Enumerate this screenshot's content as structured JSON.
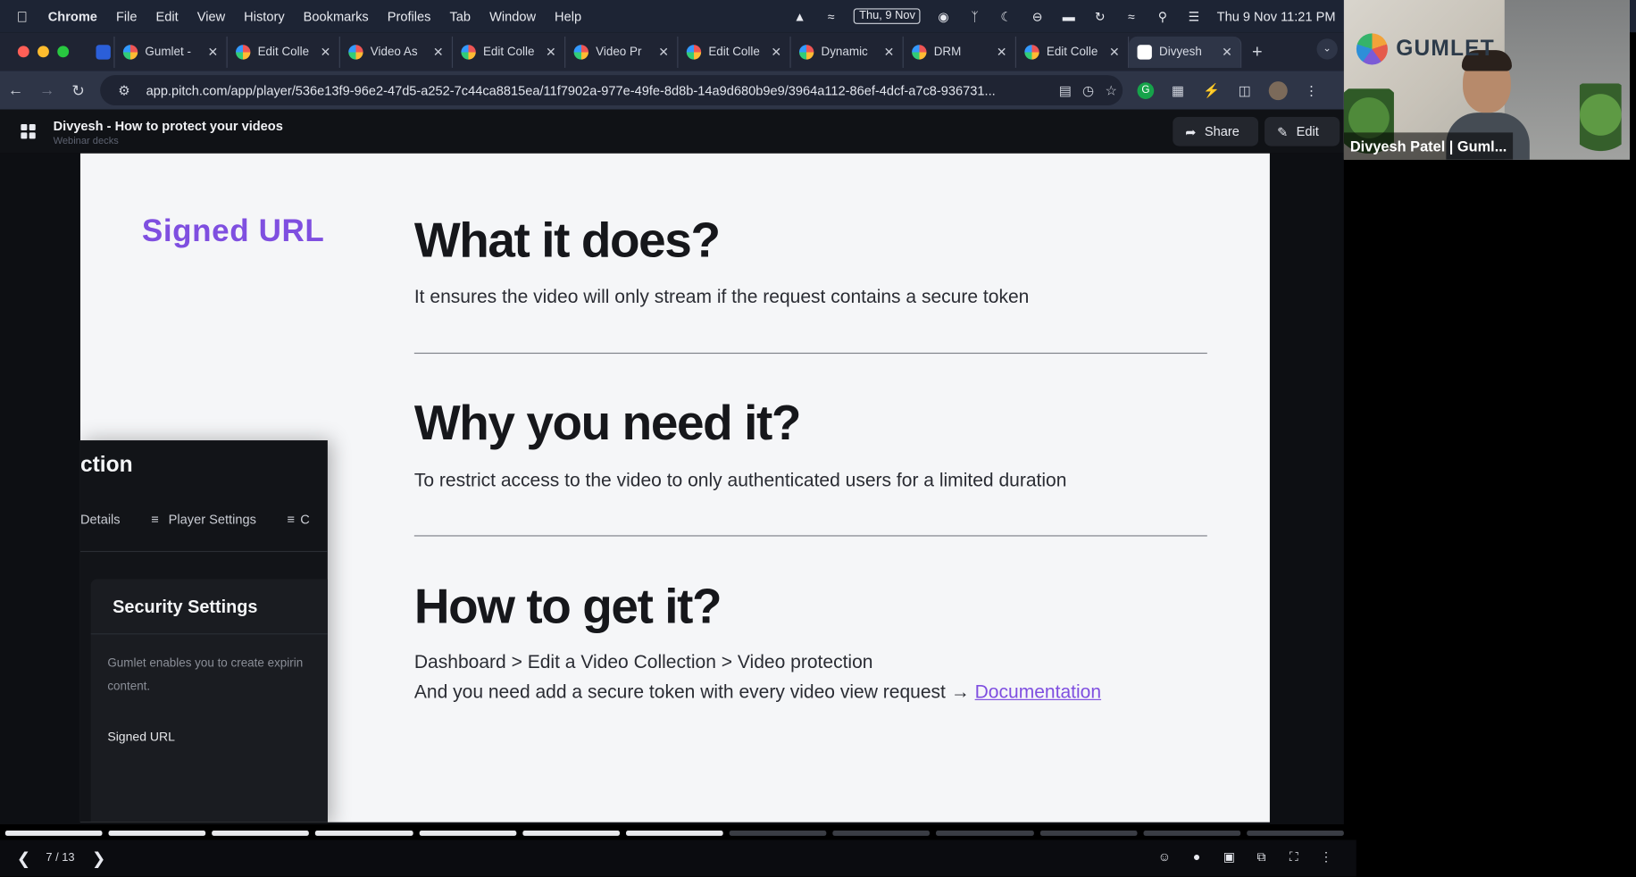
{
  "menubar": {
    "app": "Chrome",
    "menus": [
      "File",
      "Edit",
      "View",
      "History",
      "Bookmarks",
      "Profiles",
      "Tab",
      "Window",
      "Help"
    ],
    "date_badge": "Thu, 9 Nov",
    "clock": "Thu 9 Nov  11:21 PM"
  },
  "tabs": [
    {
      "title": "Gumlet -"
    },
    {
      "title": "Edit Colle"
    },
    {
      "title": "Video As"
    },
    {
      "title": "Edit Colle"
    },
    {
      "title": "Video Pr"
    },
    {
      "title": "Edit Colle"
    },
    {
      "title": "Dynamic"
    },
    {
      "title": "DRM"
    },
    {
      "title": "Edit Colle"
    },
    {
      "title": "Divyesh"
    }
  ],
  "browser": {
    "url": "app.pitch.com/app/player/536e13f9-96e2-47d5-a252-7c44ca8815ea/11f7902a-977e-49fe-8d8b-14a9d680b9e9/3964a112-86ef-4dcf-a7c8-936731..."
  },
  "pitch": {
    "deck_title": "Divyesh - How to protect your videos",
    "deck_subtitle": "Webinar decks",
    "share_label": "Share",
    "edit_label": "Edit"
  },
  "slide": {
    "section_label": "Signed URL",
    "h1": "What it does?",
    "p1": "It ensures the video will only stream if the request contains a secure token",
    "h2": "Why you need it?",
    "p2": "To restrict access to the video to only authenticated users for a limited duration",
    "h3": "How to get it?",
    "p3a": "Dashboard > Edit a Video Collection > Video protection",
    "p3b": "And you need add a secure token with every video view request → ",
    "link": "Documentation"
  },
  "inset": {
    "heading_fragment": "ction",
    "tab_details": "Details",
    "tab_player_settings": "Player Settings",
    "tab_cut": "C",
    "card_title": "Security Settings",
    "card_desc": "Gumlet enables you to create expirin",
    "card_desc2": "content.",
    "card_option": "Signed URL"
  },
  "player": {
    "counter": "7 / 13",
    "current_slide": 7,
    "total_slides": 13
  },
  "webcam": {
    "brand": "GUMLET",
    "presenter_name": "Divyesh Patel | Guml..."
  },
  "colors": {
    "accent": "#7f4fe0",
    "menubar": "#1d2434",
    "slide_bg": "#f5f6f8"
  }
}
